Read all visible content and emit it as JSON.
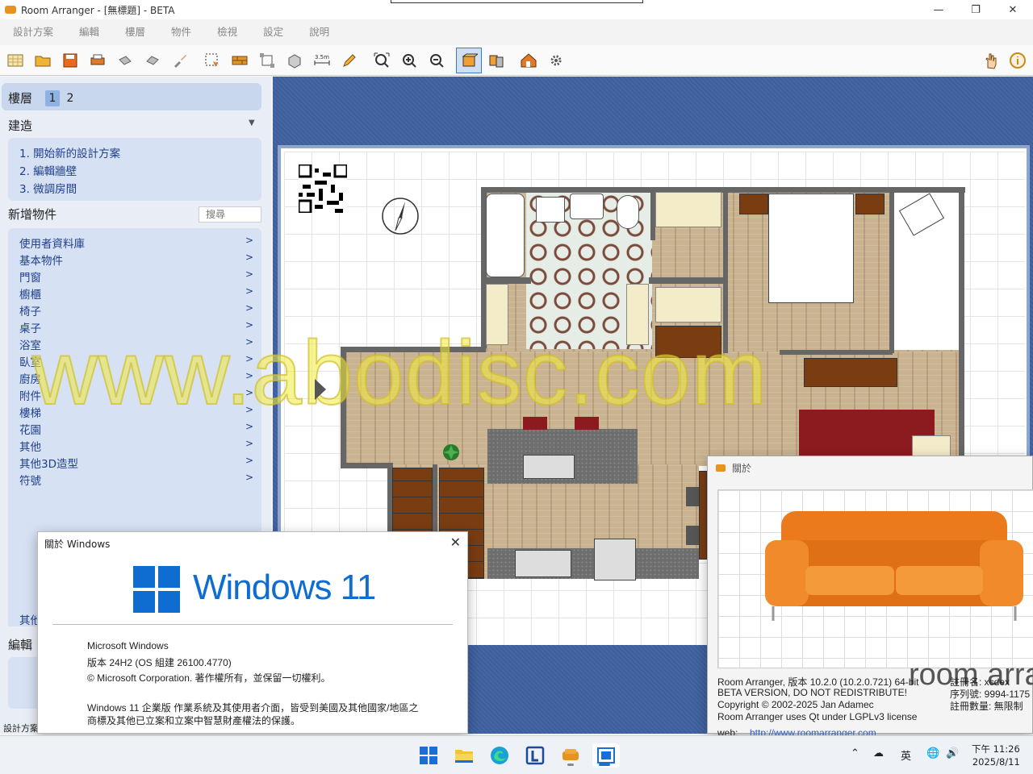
{
  "window": {
    "title": "Room Arranger - [無標題] - BETA",
    "minimize_icon": "minimize-icon",
    "maximize_icon": "restore-icon",
    "close_icon": "close-icon"
  },
  "menu": [
    "設計方案",
    "編輯",
    "樓層",
    "物件",
    "檢視",
    "設定",
    "說明"
  ],
  "toolbar": {
    "tools": [
      "new-project",
      "open-folder",
      "save",
      "print",
      "undo",
      "redo",
      "paint-brush",
      "select-area",
      "wall",
      "dimensions",
      "3d-block",
      "measure-3.5m",
      "pencil",
      "zoom-fit",
      "zoom-in",
      "zoom-out",
      "2d-view",
      "3d-objects",
      "house-3d",
      "settings-gear",
      "hand-tool",
      "info"
    ],
    "measure_label": "3.5m"
  },
  "left_panel": {
    "floor_label": "樓層",
    "floors": [
      "1",
      "2"
    ],
    "build_title": "建造",
    "steps": [
      "1. 開始新的設計方案",
      "2. 編輯牆壁",
      "3. 微調房間"
    ],
    "add_objects_title": "新增物件",
    "search_placeholder": "搜尋",
    "categories": [
      "使用者資料庫",
      "基本物件",
      "門窗",
      "櫥櫃",
      "椅子",
      "桌子",
      "浴室",
      "臥室",
      "廚房",
      "附件",
      "樓梯",
      "花園",
      "其他",
      "其他3D造型",
      "符號"
    ],
    "other_label": "其他",
    "edit_title": "編輯",
    "status_label": "設計方案"
  },
  "about_windows": {
    "title": "關於 Windows",
    "logo_text": "Windows 11",
    "lines": [
      "Microsoft Windows",
      "版本 24H2 (OS 組建 26100.4770)",
      "© Microsoft Corporation. 著作權所有，並保留一切權利。",
      "Windows 11 企業版 作業系統及其使用者介面，皆受到美國及其他國家/地區之",
      "商標及其他已立案和立案中智慧財產權法的保護。"
    ]
  },
  "about_ra": {
    "title": "關於",
    "brand": "room arra",
    "lines": [
      "Room Arranger, 版本 10.2.0 (10.2.0.721) 64-bit",
      "BETA VERSION, DO NOT REDISTRIBUTE!",
      "Copyright © 2002-2025 Jan Adamec",
      "Room Arranger uses Qt under LGPLv3 license"
    ],
    "web_label": "web:",
    "web_url": "http://www.roomarranger.com",
    "reg_name": "註冊名: xcdex",
    "serial": "序列號: 9994-1175",
    "reg_count": "註冊數量: 無限制"
  },
  "watermark": "www.abodisc.com",
  "taskbar": {
    "apps": [
      "windows-start-icon",
      "file-explorer-icon",
      "edge-browser-icon",
      "app-l-icon",
      "room-arranger-icon",
      "active-window-icon"
    ],
    "tray": [
      "chevron-up-icon",
      "cloud-icon",
      "英",
      "network-icon",
      "speaker-icon"
    ],
    "time": "下午 11:26",
    "date": "2025/8/11"
  },
  "colors": {
    "accent": "#0f6cd0",
    "canvas_bg": "#3d5e9c",
    "panel_bg": "#d6e1f3",
    "link": "#1f3f8a"
  }
}
